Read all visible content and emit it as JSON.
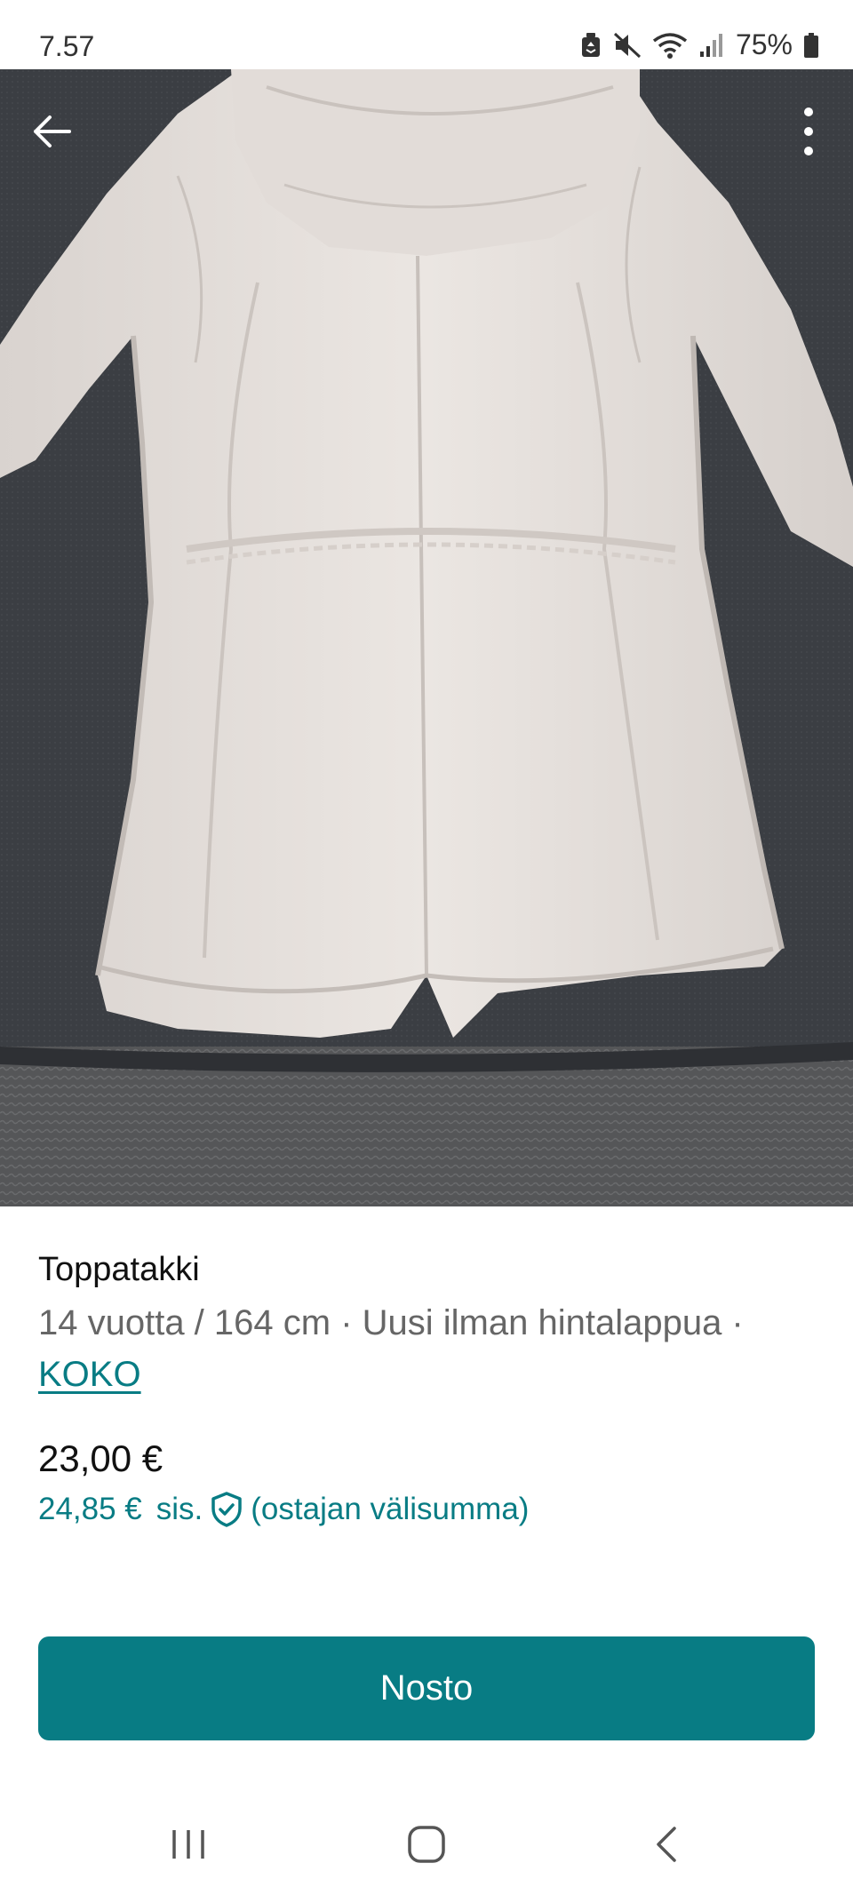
{
  "status_bar": {
    "time": "7.57",
    "battery": "75%",
    "icons": [
      "recycle-bin-icon",
      "mute-icon",
      "wifi-icon",
      "signal-icon",
      "battery-icon"
    ]
  },
  "top_bar": {
    "back_icon": "arrow-left-icon",
    "menu_icon": "more-vertical-icon"
  },
  "gallery": {
    "photo_count": 4,
    "active_index": 1,
    "colors": {
      "background": "#3a3d42",
      "jacket": "#e6e0dc",
      "floor_rug": "#5a5b5d"
    }
  },
  "item": {
    "title": "Toppatakki",
    "details": "14 vuotta / 164 cm · Uusi ilman hintalappua ·",
    "size_link": "KOKO",
    "price": "23,00 €",
    "price_incl": "24,85 €",
    "incl_label": "sis.",
    "incl_suffix": "(ostajan välisumma)",
    "protection_icon": "shield-check-icon"
  },
  "actions": {
    "buy_label": "Nosto"
  },
  "nav": {
    "recent_icon": "recent-apps-icon",
    "home_icon": "home-icon",
    "back_icon": "back-chevron-icon"
  },
  "colors": {
    "accent": "#087c84",
    "text_primary": "#111111",
    "text_secondary": "#666666"
  }
}
